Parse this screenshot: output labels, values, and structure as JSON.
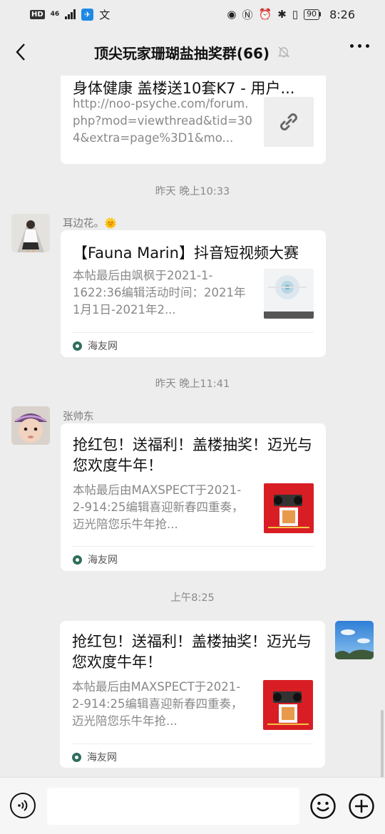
{
  "status_bar": {
    "hd": "HD",
    "network": "4G",
    "network_sub": "46",
    "battery": "90",
    "time": "8:26",
    "icons": [
      "hd-icon",
      "signal-icon",
      "app-icon",
      "translate-icon",
      "eye-icon",
      "nfc-icon",
      "alarm-icon",
      "bluetooth-icon",
      "vibrate-icon",
      "battery-icon"
    ]
  },
  "header": {
    "title": "顶尖玩家珊瑚盐抽奖群(66)",
    "icons": [
      "back-icon",
      "mute-bell-icon",
      "more-icon"
    ]
  },
  "messages": [
    {
      "type": "link-card",
      "title": "身体健康 盖楼送10套K7 - 用户...",
      "desc": "http://noo-psyche.com/forum.php?mod=viewthread&tid=304&extra=page%3D1&mo...",
      "thumb": "link-icon"
    },
    {
      "type": "timestamp",
      "text": "昨天 晚上10:33"
    },
    {
      "type": "link-card",
      "sender": "耳边花。🌞",
      "title": "【Fauna Marin】抖音短视频大赛",
      "desc": "本帖最后由飒枫于2021-1-1622:36编辑活动时间：2021年1月1日-2021年2...",
      "source": "海友网",
      "thumb": "video-thumbnail"
    },
    {
      "type": "timestamp",
      "text": "昨天 晚上11:41"
    },
    {
      "type": "link-card",
      "sender": "张帅东",
      "title": "抢红包！送福利！盖楼抽奖！迈光与您欢度牛年！",
      "desc": "本帖最后由MAXSPECT于2021-2-914:25编辑喜迎新春四重奏，迈光陪您乐牛年抢...",
      "source": "海友网",
      "thumb": "red-promo-thumbnail"
    },
    {
      "type": "timestamp",
      "text": "上午8:25"
    },
    {
      "type": "link-card",
      "self": true,
      "title": "抢红包！送福利！盖楼抽奖！迈光与您欢度牛年！",
      "desc": "本帖最后由MAXSPECT于2021-2-914:25编辑喜迎新春四重奏，迈光陪您乐牛年抢...",
      "source": "海友网",
      "thumb": "red-promo-thumbnail"
    }
  ],
  "input_bar": {
    "placeholder": "",
    "icons": [
      "voice-icon",
      "emoji-icon",
      "plus-icon"
    ]
  },
  "colors": {
    "background": "#ededed",
    "card": "#ffffff",
    "secondary_text": "#888888",
    "accent_red": "#d81e24"
  }
}
